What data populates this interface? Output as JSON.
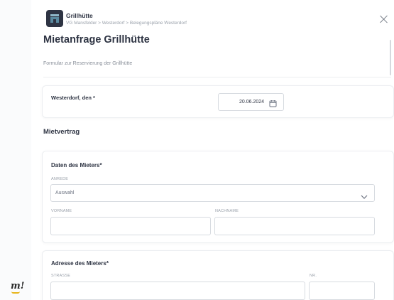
{
  "header": {
    "app_title": "Grillhütte",
    "breadcrumb": [
      "VG Mansfelder",
      "Westerdorf",
      "Belegungspläne Westerdorf"
    ],
    "breadcrumb_sep": ">",
    "close_icon": "close-icon"
  },
  "page": {
    "title": "Mietanfrage Grillhütte",
    "subtitle": "Formular zur Reservierung der Grillhütte"
  },
  "date_section": {
    "label": "Westerdorf, den *",
    "value": "20.06.2024",
    "icon": "calendar-icon"
  },
  "mietvertrag": {
    "heading": "Mietvertrag",
    "tenant": {
      "heading": "Daten des Mieters*",
      "anrede_label": "ANREDE",
      "anrede_value": "Auswahl",
      "vorname_label": "VORNAME",
      "vorname_value": "",
      "nachname_label": "NACHNAME",
      "nachname_value": ""
    },
    "address": {
      "heading": "Adresse des Mieters*",
      "strasse_label": "STRASSE",
      "strasse_value": "",
      "nr_label": "NR.",
      "nr_value": ""
    }
  },
  "brand": {
    "logo_text": "m!",
    "accent": "#e7b51a",
    "dark": "#2e3443"
  }
}
